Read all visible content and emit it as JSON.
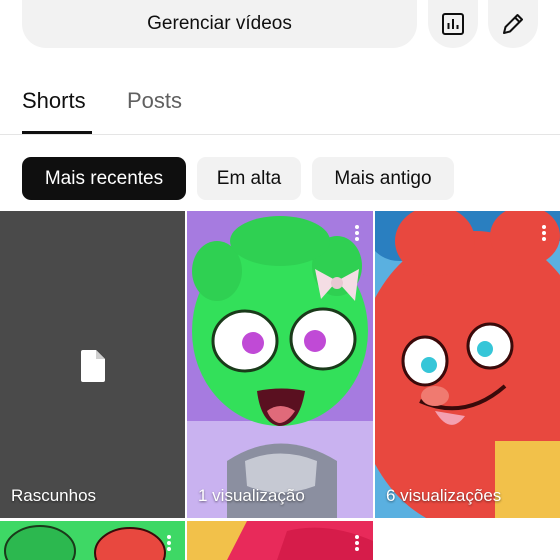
{
  "header": {
    "manage_videos_label": "Gerenciar vídeos",
    "analytics_icon": "analytics-icon",
    "edit_icon": "pencil-icon"
  },
  "tabs": [
    {
      "label": "Shorts",
      "selected": true
    },
    {
      "label": "Posts",
      "selected": false
    }
  ],
  "filters": [
    {
      "label": "Mais recentes",
      "selected": true
    },
    {
      "label": "Em alta",
      "selected": false
    },
    {
      "label": "Mais antigo",
      "selected": false
    }
  ],
  "grid": {
    "items": [
      {
        "label": "Rascunhos",
        "icon": "draft-file-icon"
      },
      {
        "label": "1 visualização"
      },
      {
        "label": "6 visualizações"
      }
    ]
  },
  "colors": {
    "chip_selected_bg": "#0f0f0f",
    "chip_bg": "#f2f2f2",
    "drafts_bg": "#4a4a4a"
  }
}
